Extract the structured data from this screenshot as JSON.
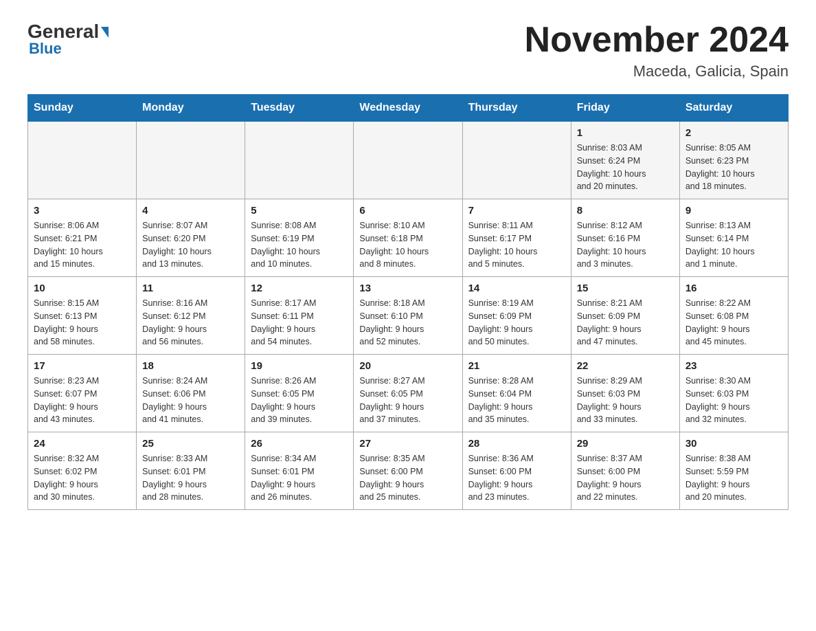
{
  "header": {
    "logo_main": "General",
    "logo_blue": "Blue",
    "month": "November 2024",
    "location": "Maceda, Galicia, Spain"
  },
  "weekdays": [
    "Sunday",
    "Monday",
    "Tuesday",
    "Wednesday",
    "Thursday",
    "Friday",
    "Saturday"
  ],
  "weeks": [
    [
      {
        "day": "",
        "info": ""
      },
      {
        "day": "",
        "info": ""
      },
      {
        "day": "",
        "info": ""
      },
      {
        "day": "",
        "info": ""
      },
      {
        "day": "",
        "info": ""
      },
      {
        "day": "1",
        "info": "Sunrise: 8:03 AM\nSunset: 6:24 PM\nDaylight: 10 hours\nand 20 minutes."
      },
      {
        "day": "2",
        "info": "Sunrise: 8:05 AM\nSunset: 6:23 PM\nDaylight: 10 hours\nand 18 minutes."
      }
    ],
    [
      {
        "day": "3",
        "info": "Sunrise: 8:06 AM\nSunset: 6:21 PM\nDaylight: 10 hours\nand 15 minutes."
      },
      {
        "day": "4",
        "info": "Sunrise: 8:07 AM\nSunset: 6:20 PM\nDaylight: 10 hours\nand 13 minutes."
      },
      {
        "day": "5",
        "info": "Sunrise: 8:08 AM\nSunset: 6:19 PM\nDaylight: 10 hours\nand 10 minutes."
      },
      {
        "day": "6",
        "info": "Sunrise: 8:10 AM\nSunset: 6:18 PM\nDaylight: 10 hours\nand 8 minutes."
      },
      {
        "day": "7",
        "info": "Sunrise: 8:11 AM\nSunset: 6:17 PM\nDaylight: 10 hours\nand 5 minutes."
      },
      {
        "day": "8",
        "info": "Sunrise: 8:12 AM\nSunset: 6:16 PM\nDaylight: 10 hours\nand 3 minutes."
      },
      {
        "day": "9",
        "info": "Sunrise: 8:13 AM\nSunset: 6:14 PM\nDaylight: 10 hours\nand 1 minute."
      }
    ],
    [
      {
        "day": "10",
        "info": "Sunrise: 8:15 AM\nSunset: 6:13 PM\nDaylight: 9 hours\nand 58 minutes."
      },
      {
        "day": "11",
        "info": "Sunrise: 8:16 AM\nSunset: 6:12 PM\nDaylight: 9 hours\nand 56 minutes."
      },
      {
        "day": "12",
        "info": "Sunrise: 8:17 AM\nSunset: 6:11 PM\nDaylight: 9 hours\nand 54 minutes."
      },
      {
        "day": "13",
        "info": "Sunrise: 8:18 AM\nSunset: 6:10 PM\nDaylight: 9 hours\nand 52 minutes."
      },
      {
        "day": "14",
        "info": "Sunrise: 8:19 AM\nSunset: 6:09 PM\nDaylight: 9 hours\nand 50 minutes."
      },
      {
        "day": "15",
        "info": "Sunrise: 8:21 AM\nSunset: 6:09 PM\nDaylight: 9 hours\nand 47 minutes."
      },
      {
        "day": "16",
        "info": "Sunrise: 8:22 AM\nSunset: 6:08 PM\nDaylight: 9 hours\nand 45 minutes."
      }
    ],
    [
      {
        "day": "17",
        "info": "Sunrise: 8:23 AM\nSunset: 6:07 PM\nDaylight: 9 hours\nand 43 minutes."
      },
      {
        "day": "18",
        "info": "Sunrise: 8:24 AM\nSunset: 6:06 PM\nDaylight: 9 hours\nand 41 minutes."
      },
      {
        "day": "19",
        "info": "Sunrise: 8:26 AM\nSunset: 6:05 PM\nDaylight: 9 hours\nand 39 minutes."
      },
      {
        "day": "20",
        "info": "Sunrise: 8:27 AM\nSunset: 6:05 PM\nDaylight: 9 hours\nand 37 minutes."
      },
      {
        "day": "21",
        "info": "Sunrise: 8:28 AM\nSunset: 6:04 PM\nDaylight: 9 hours\nand 35 minutes."
      },
      {
        "day": "22",
        "info": "Sunrise: 8:29 AM\nSunset: 6:03 PM\nDaylight: 9 hours\nand 33 minutes."
      },
      {
        "day": "23",
        "info": "Sunrise: 8:30 AM\nSunset: 6:03 PM\nDaylight: 9 hours\nand 32 minutes."
      }
    ],
    [
      {
        "day": "24",
        "info": "Sunrise: 8:32 AM\nSunset: 6:02 PM\nDaylight: 9 hours\nand 30 minutes."
      },
      {
        "day": "25",
        "info": "Sunrise: 8:33 AM\nSunset: 6:01 PM\nDaylight: 9 hours\nand 28 minutes."
      },
      {
        "day": "26",
        "info": "Sunrise: 8:34 AM\nSunset: 6:01 PM\nDaylight: 9 hours\nand 26 minutes."
      },
      {
        "day": "27",
        "info": "Sunrise: 8:35 AM\nSunset: 6:00 PM\nDaylight: 9 hours\nand 25 minutes."
      },
      {
        "day": "28",
        "info": "Sunrise: 8:36 AM\nSunset: 6:00 PM\nDaylight: 9 hours\nand 23 minutes."
      },
      {
        "day": "29",
        "info": "Sunrise: 8:37 AM\nSunset: 6:00 PM\nDaylight: 9 hours\nand 22 minutes."
      },
      {
        "day": "30",
        "info": "Sunrise: 8:38 AM\nSunset: 5:59 PM\nDaylight: 9 hours\nand 20 minutes."
      }
    ]
  ]
}
